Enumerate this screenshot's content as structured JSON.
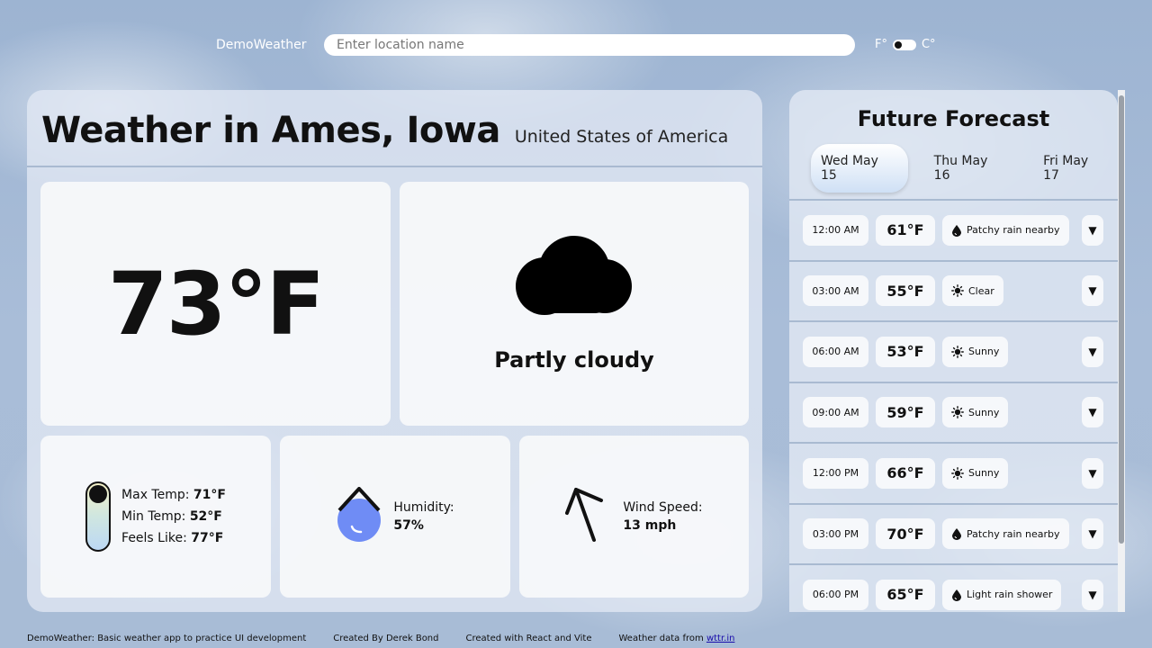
{
  "header": {
    "app_title": "DemoWeather",
    "search_placeholder": "Enter location name",
    "unit_f": "F°",
    "unit_c": "C°"
  },
  "main": {
    "title": "Weather in Ames, Iowa",
    "country": "United States of America",
    "temperature": "73°F",
    "condition": "Partly cloudy",
    "condition_icon": "cloud-icon",
    "max_label": "Max Temp:",
    "max_value": "71°F",
    "min_label": "Min Temp:",
    "min_value": "52°F",
    "feels_label": "Feels Like:",
    "feels_value": "77°F",
    "humidity_label": "Humidity:",
    "humidity_value": "57%",
    "wind_label": "Wind Speed:",
    "wind_value": "13 mph"
  },
  "forecast": {
    "title": "Future Forecast",
    "tabs": [
      {
        "label": "Wed May 15",
        "active": true
      },
      {
        "label": "Thu May 16",
        "active": false
      },
      {
        "label": "Fri May 17",
        "active": false
      }
    ],
    "rows": [
      {
        "time": "12:00 AM",
        "temp": "61°F",
        "icon": "raindrop-icon",
        "cond": "Patchy rain nearby"
      },
      {
        "time": "03:00 AM",
        "temp": "55°F",
        "icon": "sun-icon",
        "cond": "Clear"
      },
      {
        "time": "06:00 AM",
        "temp": "53°F",
        "icon": "sun-icon",
        "cond": "Sunny"
      },
      {
        "time": "09:00 AM",
        "temp": "59°F",
        "icon": "sun-icon",
        "cond": "Sunny"
      },
      {
        "time": "12:00 PM",
        "temp": "66°F",
        "icon": "sun-icon",
        "cond": "Sunny"
      },
      {
        "time": "03:00 PM",
        "temp": "70°F",
        "icon": "raindrop-icon",
        "cond": "Patchy rain nearby"
      },
      {
        "time": "06:00 PM",
        "temp": "65°F",
        "icon": "raindrop-icon",
        "cond": "Light rain shower"
      }
    ],
    "expand_glyph": "▼"
  },
  "footer": {
    "about": "DemoWeather: Basic weather app to practice UI development",
    "author": "Created By Derek Bond",
    "tech": "Created with React and Vite",
    "source_prefix": "Weather data from ",
    "source_link": "wttr.in"
  },
  "colors": {
    "humidity_fill": "#6f8cf5",
    "divider": "#a9bad1"
  }
}
